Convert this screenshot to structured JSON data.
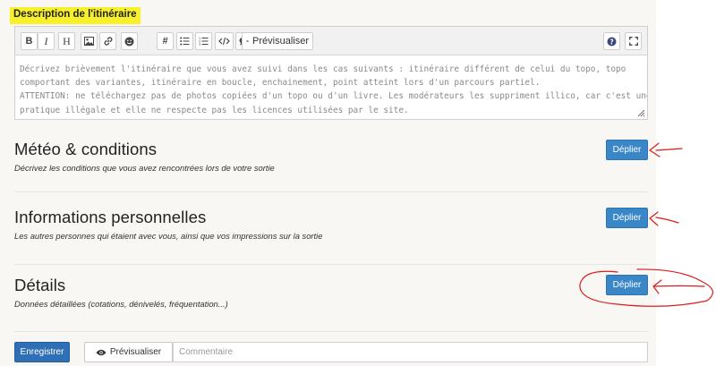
{
  "description": {
    "label": "Description de l'itinéraire",
    "placeholder_lines": [
      "Décrivez brièvement l'itinéraire que vous avez suivi dans les cas suivants : itinéraire différent de celui du topo, topo",
      "comportant des variantes, itinéraire en boucle, enchainement, point atteint lors d'un parcours partiel.",
      "ATTENTION: ne téléchargez pas de photos copiées d'un topo ou d'un livre. Les modérateurs les suppriment illico, car c'est une",
      "pratique illégale et elle ne respecte pas les licences utilisées par le site."
    ]
  },
  "toolbar": {
    "buttons": [
      {
        "name": "bold",
        "icon": "bold-icon",
        "glyph": "B"
      },
      {
        "name": "italic",
        "icon": "italic-icon",
        "glyph": "I"
      },
      {
        "name": "heading",
        "icon": "heading-icon",
        "glyph": "H"
      },
      {
        "name": "image",
        "icon": "image-icon"
      },
      {
        "name": "link",
        "icon": "link-icon"
      },
      {
        "name": "emoji",
        "icon": "emoji-icon"
      },
      {
        "name": "hashtag",
        "icon": "hashtag-icon",
        "glyph": "#"
      },
      {
        "name": "bullet-list",
        "icon": "bullet-list-icon"
      },
      {
        "name": "numbered-list",
        "icon": "numbered-list-icon"
      },
      {
        "name": "code",
        "icon": "code-icon"
      },
      {
        "name": "comment",
        "icon": "comment-icon"
      }
    ],
    "preview_label": "Prévisualiser",
    "help_icon": "help-icon",
    "fullscreen_icon": "fullscreen-icon"
  },
  "sections": [
    {
      "id": "meteo",
      "title": "Météo & conditions",
      "subtitle": "Décrivez les conditions que vous avez rencontrées lors de votre sortie",
      "button": "Déplier"
    },
    {
      "id": "infos",
      "title": "Informations personnelles",
      "subtitle": "Les autres personnes qui étaient avec vous, ainsi que vos impressions sur la sortie",
      "button": "Déplier"
    },
    {
      "id": "details",
      "title": "Détails",
      "subtitle": "Données détaillées (cotations, dénivelés, fréquentation...)",
      "button": "Déplier"
    }
  ],
  "footer": {
    "save_label": "Enregistrer",
    "preview_label": "Prévisualiser",
    "comment_placeholder": "Commentaire"
  },
  "colors": {
    "highlight": "#f7f02a",
    "primary": "#3a87c8",
    "annotation": "#d91c1c"
  }
}
